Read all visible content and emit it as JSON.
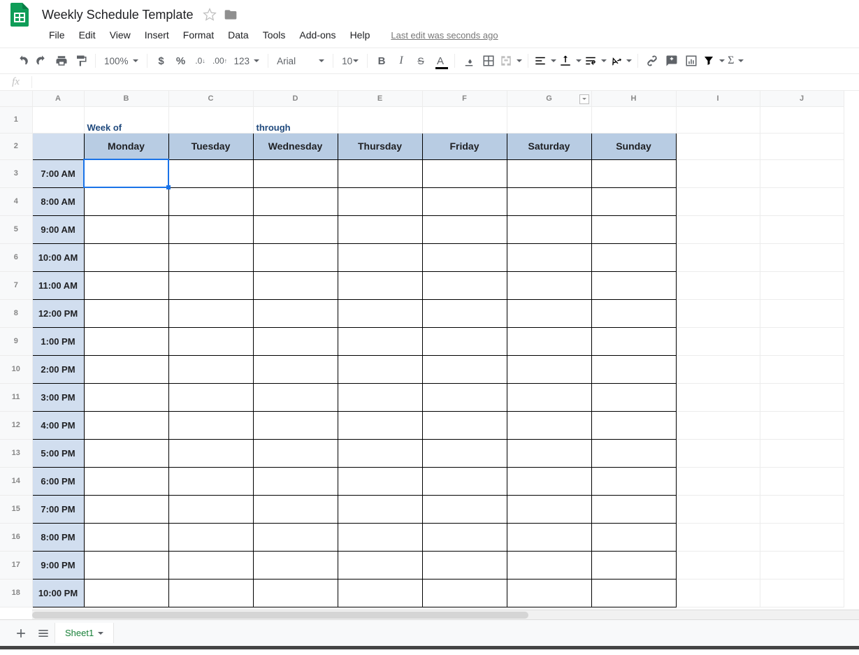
{
  "doc": {
    "title": "Weekly Schedule Template",
    "last_edit": "Last edit was seconds ago"
  },
  "menus": [
    "File",
    "Edit",
    "View",
    "Insert",
    "Format",
    "Data",
    "Tools",
    "Add-ons",
    "Help"
  ],
  "toolbar": {
    "zoom": "100%",
    "more_formats": "123",
    "font": "Arial",
    "font_size": "10"
  },
  "columns": [
    "A",
    "B",
    "C",
    "D",
    "E",
    "F",
    "G",
    "H",
    "I",
    "J"
  ],
  "row_numbers": [
    "1",
    "2",
    "3",
    "4",
    "5",
    "6",
    "7",
    "8",
    "9",
    "10",
    "11",
    "12",
    "13",
    "14",
    "15",
    "16",
    "17",
    "18"
  ],
  "header_row": {
    "b": "Week of",
    "d": "through"
  },
  "days": [
    "Monday",
    "Tuesday",
    "Wednesday",
    "Thursday",
    "Friday",
    "Saturday",
    "Sunday"
  ],
  "times": [
    "7:00 AM",
    "8:00 AM",
    "9:00 AM",
    "10:00 AM",
    "11:00 AM",
    "12:00 PM",
    "1:00 PM",
    "2:00 PM",
    "3:00 PM",
    "4:00 PM",
    "5:00 PM",
    "6:00 PM",
    "7:00 PM",
    "8:00 PM",
    "9:00 PM",
    "10:00 PM"
  ],
  "sheet_tab": "Sheet1",
  "active_cell": "B3"
}
